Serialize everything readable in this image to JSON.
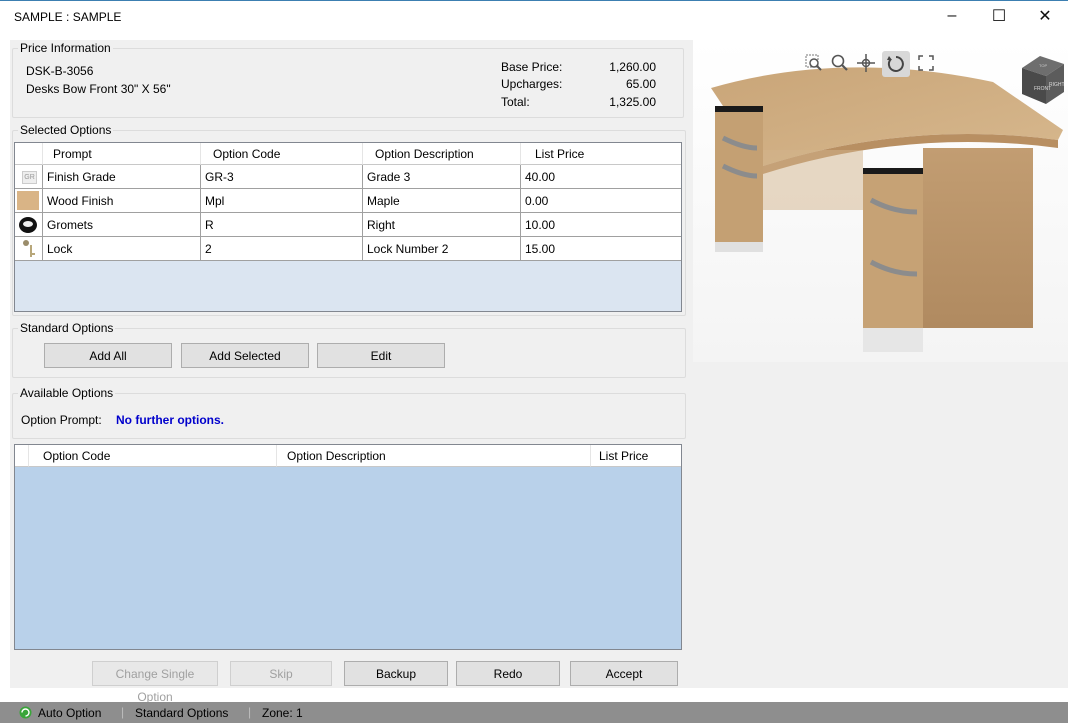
{
  "window": {
    "title": "SAMPLE : SAMPLE",
    "minimize": "–",
    "maximize": "☐",
    "close": "✕"
  },
  "price_info": {
    "label": "Price Information",
    "part": "DSK-B-3056",
    "description": "Desks Bow Front 30\" X 56\"",
    "base_label": "Base Price:",
    "base_value": "1,260.00",
    "upcharges_label": "Upcharges:",
    "upcharges_value": "65.00",
    "total_label": "Total:",
    "total_value": "1,325.00"
  },
  "selected_options": {
    "label": "Selected Options",
    "headers": [
      "Prompt",
      "Option Code",
      "Option Description",
      "List Price"
    ],
    "rows": [
      {
        "prompt": "Finish Grade",
        "code": "GR-3",
        "desc": "Grade 3",
        "price": "40.00",
        "icon": "grade-icon"
      },
      {
        "prompt": "Wood Finish",
        "code": "Mpl",
        "desc": "Maple",
        "price": "0.00",
        "icon": "maple-swatch-icon"
      },
      {
        "prompt": "Gromets",
        "code": "R",
        "desc": "Right",
        "price": "10.00",
        "icon": "grommet-icon"
      },
      {
        "prompt": "Lock",
        "code": "2",
        "desc": "Lock Number 2",
        "price": "15.00",
        "icon": "key-icon"
      }
    ]
  },
  "standard_options": {
    "label": "Standard Options",
    "add_all": "Add All",
    "add_selected": "Add Selected",
    "edit": "Edit"
  },
  "available_options": {
    "label": "Available Options",
    "prompt_label": "Option Prompt:",
    "prompt_value": "No further options.",
    "headers": [
      "Option Code",
      "Option Description",
      "List Price"
    ]
  },
  "actions": {
    "change_single": "Change Single Option",
    "skip": "Skip",
    "backup": "Backup",
    "redo": "Redo",
    "accept": "Accept"
  },
  "viewer_toolbar": [
    "zoom-window-icon",
    "zoom-icon",
    "pan-icon",
    "rotate-icon",
    "fullscreen-icon"
  ],
  "viewcube": {
    "top": "TOP",
    "front": "FRONT",
    "right": "RIGHT"
  },
  "status": {
    "mode": "Auto Option",
    "section": "Standard Options",
    "zone": "Zone: 1"
  },
  "colors": {
    "grid_empty": "#b9d1ea",
    "selected_empty": "#dbe5f1",
    "link_blue": "#0000cc",
    "maple": "#d9b486"
  }
}
